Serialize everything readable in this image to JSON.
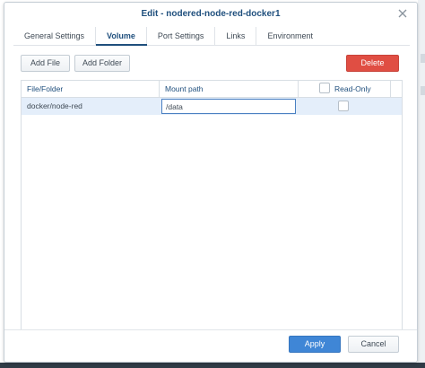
{
  "dialog": {
    "title": "Edit - nodered-node-red-docker1"
  },
  "tabs": [
    {
      "label": "General Settings",
      "active": false
    },
    {
      "label": "Volume",
      "active": true
    },
    {
      "label": "Port Settings",
      "active": false
    },
    {
      "label": "Links",
      "active": false
    },
    {
      "label": "Environment",
      "active": false
    }
  ],
  "toolbar": {
    "add_file_label": "Add File",
    "add_folder_label": "Add Folder",
    "delete_label": "Delete"
  },
  "table": {
    "columns": [
      "File/Folder",
      "Mount path",
      "Read-Only"
    ],
    "rows": [
      {
        "file_folder": "docker/node-red",
        "mount_path": "/data",
        "read_only": false
      }
    ]
  },
  "footer": {
    "apply_label": "Apply",
    "cancel_label": "Cancel"
  },
  "colors": {
    "title": "#1f4f7d",
    "delete": "#e04e43",
    "apply": "#3f86d6",
    "row_selected": "#e4eefa"
  },
  "icons": {
    "close": "close-icon"
  }
}
